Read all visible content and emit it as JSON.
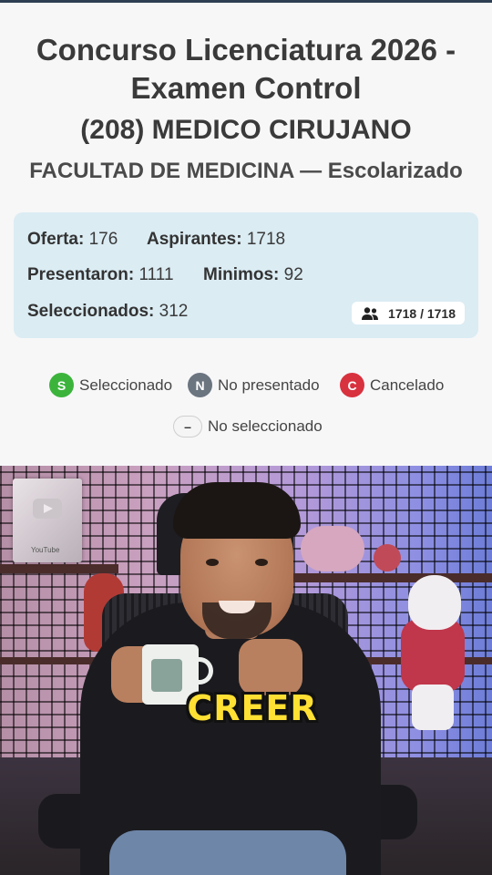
{
  "header": {
    "title": "Concurso Licenciatura 2026 - Examen Control",
    "career": "(208) MEDICO CIRUJANO",
    "faculty": "FACULTAD DE MEDICINA — Escolarizado"
  },
  "stats": {
    "oferta_label": "Oferta:",
    "oferta_value": "176",
    "aspirantes_label": "Aspirantes:",
    "aspirantes_value": "1718",
    "presentaron_label": "Presentaron:",
    "presentaron_value": "1111",
    "minimos_label": "Minimos:",
    "minimos_value": "92",
    "seleccionados_label": "Seleccionados:",
    "seleccionados_value": "312",
    "count_badge": "1718 / 1718",
    "count_icon": "users-icon"
  },
  "legend": [
    {
      "letter": "S",
      "label": "Seleccionado",
      "color": "#3cb43c"
    },
    {
      "letter": "N",
      "label": "No presentado",
      "color": "#6b7580"
    },
    {
      "letter": "C",
      "label": "Cancelado",
      "color": "#d8323f"
    },
    {
      "letter": "–",
      "label": "No seleccionado",
      "color": "#f5f5f5"
    }
  ],
  "video": {
    "caption": "CREER",
    "plaque_text": "YouTube"
  },
  "colors": {
    "stats_bg": "#dbecf3",
    "caption_color": "#ffe033",
    "text_dark": "#3a3a3a"
  }
}
